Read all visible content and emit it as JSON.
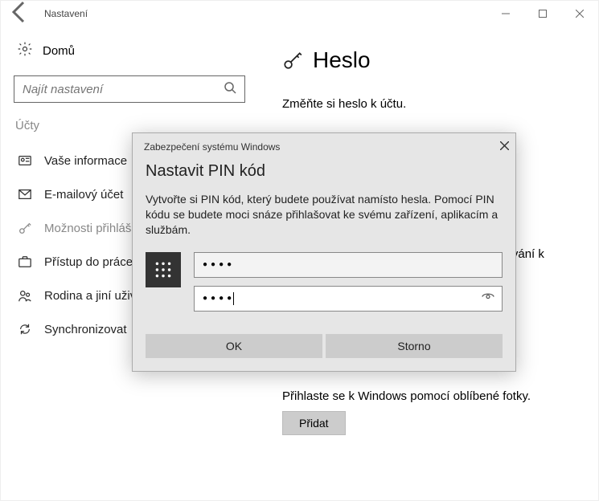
{
  "titlebar": {
    "title": "Nastavení"
  },
  "sidebar": {
    "home": "Domů",
    "search_placeholder": "Najít nastavení",
    "section": "Účty",
    "items": [
      {
        "label": "Vaše informace"
      },
      {
        "label": "E-mailový účet"
      },
      {
        "label": "Možnosti přihlášení"
      },
      {
        "label": "Přístup do práce"
      },
      {
        "label": "Rodina a jiní uživatelé"
      },
      {
        "label": "Synchronizovat"
      }
    ]
  },
  "main": {
    "heading": "Heslo",
    "desc": "Změňte si heslo k účtu.",
    "pin_partial": "hlašování k",
    "photo_desc": "Přihlaste se k Windows pomocí oblíbené fotky.",
    "add_button": "Přidat"
  },
  "dialog": {
    "title": "Zabezpečení systému Windows",
    "heading": "Nastavit PIN kód",
    "text": "Vytvořte si PIN kód, který budete používat namísto hesla. Pomocí PIN kódu se budete moci snáze přihlašovat ke svému zařízení, aplikacím a službám.",
    "pin1": "●●●●",
    "pin2": "●●●●",
    "ok": "OK",
    "cancel": "Storno"
  }
}
